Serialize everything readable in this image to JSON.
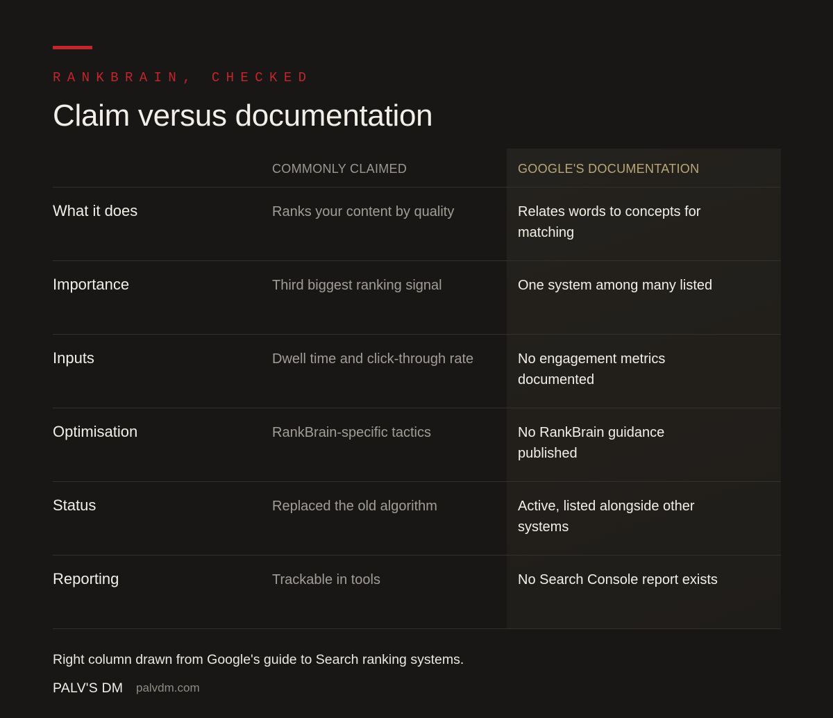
{
  "header": {
    "eyebrow": "RANKBRAIN, CHECKED",
    "title": "Claim versus documentation"
  },
  "table": {
    "columns": [
      "",
      "COMMONLY CLAIMED",
      "GOOGLE'S DOCUMENTATION"
    ],
    "rows": [
      {
        "label": "What it does",
        "claimed": "Ranks your content by quality",
        "documented": "Relates words to concepts for matching"
      },
      {
        "label": "Importance",
        "claimed": "Third biggest ranking signal",
        "documented": "One system among many listed"
      },
      {
        "label": "Inputs",
        "claimed": "Dwell time and click-through rate",
        "documented": "No engagement metrics documented"
      },
      {
        "label": "Optimisation",
        "claimed": "RankBrain-specific tactics",
        "documented": "No RankBrain guidance published"
      },
      {
        "label": "Status",
        "claimed": "Replaced the old algorithm",
        "documented": "Active, listed alongside other systems"
      },
      {
        "label": "Reporting",
        "claimed": "Trackable in tools",
        "documented": "No Search Console report exists"
      }
    ]
  },
  "footer": {
    "note": "Right column drawn from Google's guide to Search ranking systems.",
    "brand": "PALV'S DM",
    "domain": "palvdm.com"
  },
  "colors": {
    "background": "#181716",
    "accent_red": "#c4252b",
    "documentation_header": "#b8a777",
    "documentation_panel": "#23211d"
  }
}
